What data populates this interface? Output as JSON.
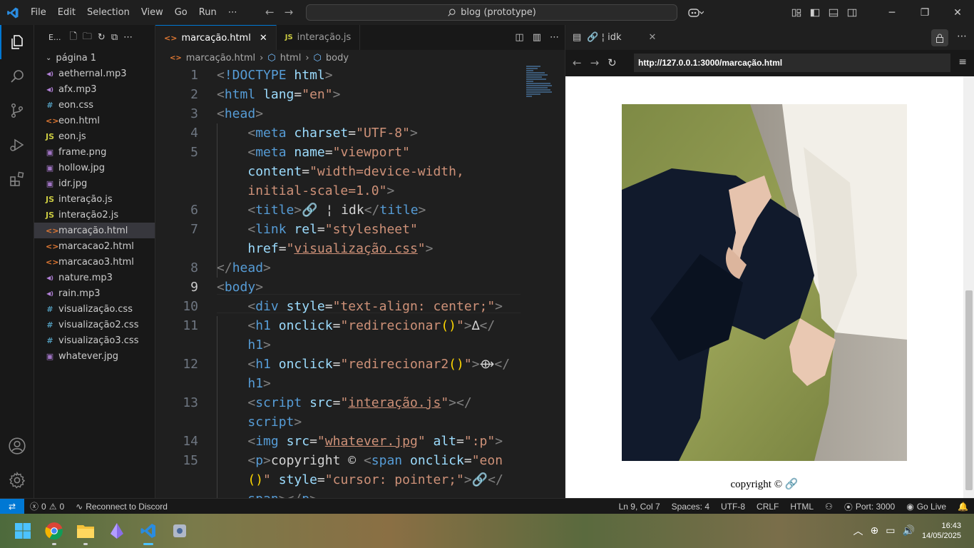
{
  "titlebar": {
    "menus": [
      "File",
      "Edit",
      "Selection",
      "View",
      "Go",
      "Run",
      "⋯"
    ],
    "search": "blog (prototype)"
  },
  "explorer": {
    "header": "E...",
    "folder": "página 1",
    "files": [
      {
        "name": "aethernal.mp3",
        "icon": "audio"
      },
      {
        "name": "afx.mp3",
        "icon": "audio"
      },
      {
        "name": "eon.css",
        "icon": "css"
      },
      {
        "name": "eon.html",
        "icon": "html"
      },
      {
        "name": "eon.js",
        "icon": "js"
      },
      {
        "name": "frame.png",
        "icon": "image"
      },
      {
        "name": "hollow.jpg",
        "icon": "image"
      },
      {
        "name": "idr.jpg",
        "icon": "image"
      },
      {
        "name": "interação.js",
        "icon": "js"
      },
      {
        "name": "interação2.js",
        "icon": "js"
      },
      {
        "name": "marcação.html",
        "icon": "html",
        "selected": true
      },
      {
        "name": "marcacao2.html",
        "icon": "html"
      },
      {
        "name": "marcacao3.html",
        "icon": "html"
      },
      {
        "name": "nature.mp3",
        "icon": "audio"
      },
      {
        "name": "rain.mp3",
        "icon": "audio"
      },
      {
        "name": "visualização.css",
        "icon": "css"
      },
      {
        "name": "visualização2.css",
        "icon": "css"
      },
      {
        "name": "visualização3.css",
        "icon": "css"
      },
      {
        "name": "whatever.jpg",
        "icon": "image"
      }
    ]
  },
  "editor": {
    "tabs": [
      {
        "label": "marcação.html",
        "active": true
      },
      {
        "label": "interação.js",
        "active": false
      }
    ],
    "breadcrumb": [
      "marcação.html",
      "html",
      "body"
    ],
    "cursor_line": 9
  },
  "preview": {
    "tab_label": "🔗 ¦ idk",
    "url": "http://127.0.0.1:3000/marcação.html",
    "copyright": "copyright © 🔗"
  },
  "statusbar": {
    "errors": "0",
    "warnings": "0",
    "discord": "Reconnect to Discord",
    "position": "Ln 9, Col 7",
    "spaces": "Spaces: 4",
    "encoding": "UTF-8",
    "eol": "CRLF",
    "language": "HTML",
    "port": "Port: 3000",
    "golive": "Go Live"
  },
  "taskbar": {
    "time": "16:43",
    "date": "14/05/2025"
  },
  "colors": {
    "accent": "#0078d4",
    "tag": "#569cd6",
    "attr": "#9cdcfe",
    "string": "#ce9178"
  }
}
